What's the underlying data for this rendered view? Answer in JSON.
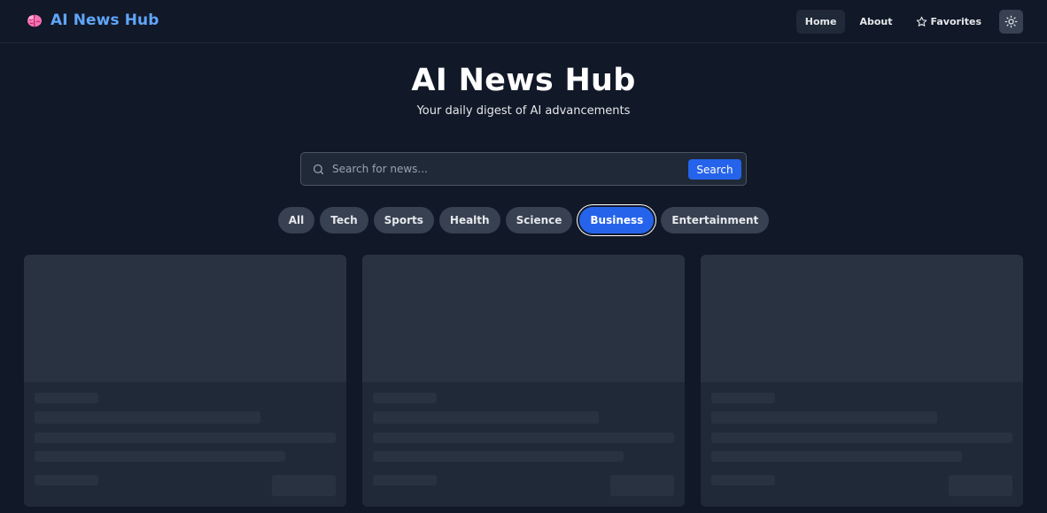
{
  "app": {
    "title": "AI News Hub"
  },
  "nav": {
    "items": [
      {
        "label": "Home",
        "active": true
      },
      {
        "label": "About",
        "active": false
      },
      {
        "label": "Favorites",
        "active": false,
        "icon": "star-icon"
      }
    ],
    "theme_toggle_icon": "sun-icon"
  },
  "hero": {
    "title": "AI News Hub",
    "subtitle": "Your daily digest of AI advancements"
  },
  "search": {
    "placeholder": "Search for news...",
    "value": "",
    "button_label": "Search"
  },
  "categories": {
    "items": [
      "All",
      "Tech",
      "Sports",
      "Health",
      "Science",
      "Business",
      "Entertainment"
    ],
    "selected": "Business"
  },
  "cards": {
    "state": "loading",
    "count": 3
  },
  "colors": {
    "background": "#111827",
    "brand": "#60a5fa",
    "accent": "#2563eb",
    "surface": "#1f2937",
    "skeleton": "#293241",
    "pill": "#374151"
  }
}
